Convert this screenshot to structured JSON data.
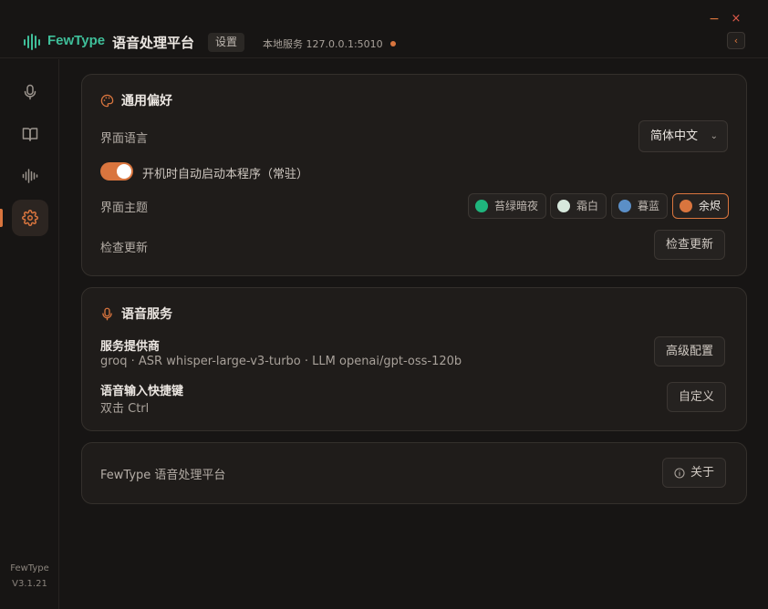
{
  "titlebar": {
    "brand": "FewType",
    "app_title": "语音处理平台",
    "settings_pill": "设置",
    "service_status": "本地服务 127.0.0.1:5010",
    "minimize": "−",
    "close": "×",
    "collapse": "‹"
  },
  "sidebar": {
    "items": [
      {
        "icon": "mic-icon"
      },
      {
        "icon": "book-icon"
      },
      {
        "icon": "waveform-icon"
      },
      {
        "icon": "gear-icon",
        "active": true
      }
    ],
    "footer_name": "FewType",
    "footer_version": "V3.1.21"
  },
  "general": {
    "title": "通用偏好",
    "language_label": "界面语言",
    "language_value": "简体中文",
    "autostart_label": "开机时自动启动本程序（常驻）",
    "autostart_on": true,
    "theme_label": "界面主题",
    "themes": [
      {
        "label": "苔绿暗夜",
        "color": "#1fb57d"
      },
      {
        "label": "霜白",
        "color": "#d7e8dc"
      },
      {
        "label": "暮蓝",
        "color": "#5b8fc7"
      },
      {
        "label": "余烬",
        "color": "#d9753e",
        "active": true
      }
    ],
    "update_label": "检查更新",
    "update_button": "检查更新"
  },
  "voice": {
    "title": "语音服务",
    "provider_title": "服务提供商",
    "provider_detail": "groq · ASR whisper-large-v3-turbo · LLM openai/gpt-oss-120b",
    "advanced_button": "高级配置",
    "hotkey_title": "语音输入快捷键",
    "hotkey_value": "双击 Ctrl",
    "customize_button": "自定义"
  },
  "about": {
    "text": "FewType 语音处理平台",
    "button": "关于"
  },
  "colors": {
    "accent": "#d9753e",
    "brand": "#3fbf9a",
    "background": "#171514",
    "card": "#1f1c1a"
  }
}
